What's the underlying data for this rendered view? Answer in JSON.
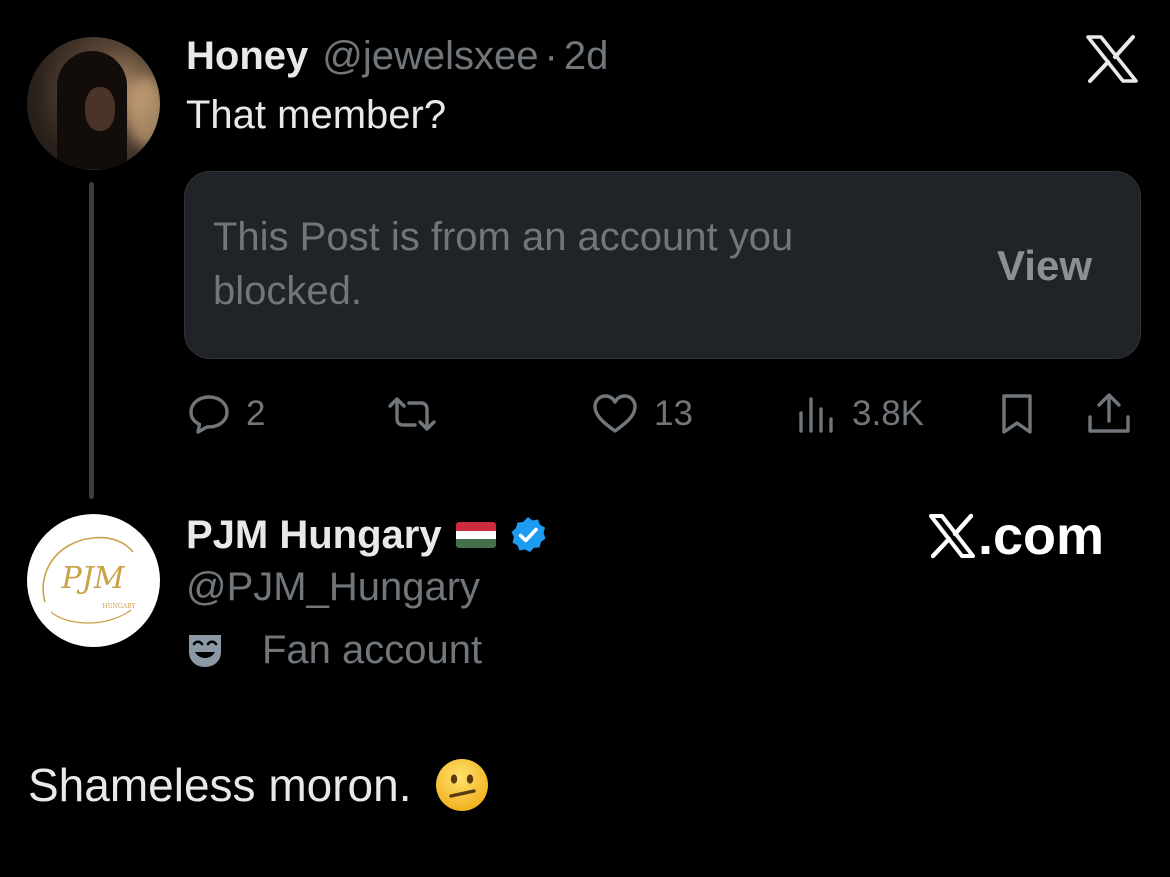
{
  "quoted_post": {
    "display_name": "Honey",
    "handle": "@jewelsxee",
    "separator": "·",
    "time": "2d",
    "text": "That member?",
    "blocked_notice": "This Post is from an account you blocked.",
    "view_label": "View",
    "metrics": {
      "replies": "2",
      "likes": "13",
      "views": "3.8K"
    },
    "icons": [
      "reply-icon",
      "repost-icon",
      "like-icon",
      "views-icon",
      "bookmark-icon",
      "share-icon",
      "x-logo-icon"
    ]
  },
  "reply_post": {
    "display_name": "PJM Hungary",
    "flag_icon": "hungary-flag-icon",
    "verified_icon": "verified-badge-icon",
    "handle": "@PJM_Hungary",
    "account_label": "Fan account",
    "account_label_icon": "theater-mask-icon",
    "avatar_text": "PJM",
    "avatar_subtext": "HUNGARY",
    "text": "Shameless moron.",
    "emoji": "confused-face-icon"
  },
  "watermark": {
    "domain_text": ".com"
  },
  "colors": {
    "background": "#000000",
    "primary_text": "#e7e9ea",
    "secondary_text": "#71767b",
    "card_background": "#202327",
    "verified_blue": "#1d9bf0",
    "flag_red": "#cd2a3e",
    "flag_white": "#ffffff",
    "flag_green": "#436f4d",
    "avatar_gold": "#c9a24a"
  }
}
